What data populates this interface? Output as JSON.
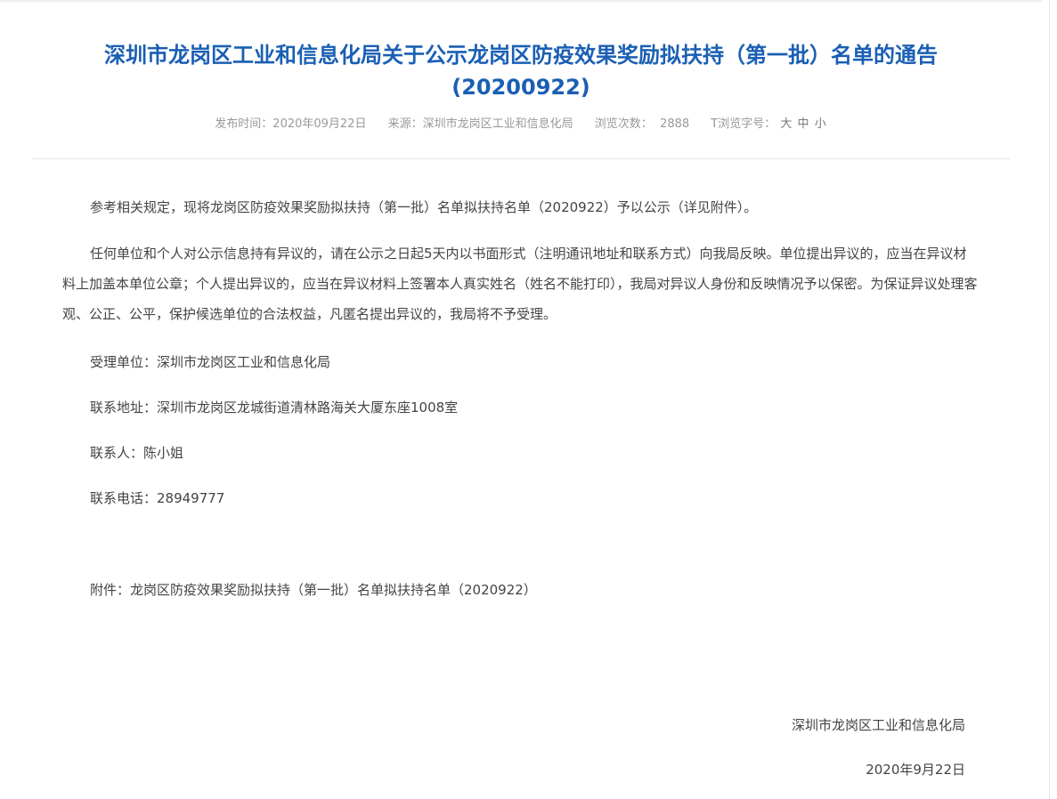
{
  "article": {
    "title_line1": "深圳市龙岗区工业和信息化局关于公示龙岗区防疫效果奖励拟扶持（第一批）名单的通告",
    "title_line2": "(20200922)",
    "meta": {
      "publish_label": "发布时间：",
      "publish_date": "2020年09月22日",
      "source_label": "来源：",
      "source": "深圳市龙岗区工业和信息化局",
      "views_label": "浏览次数：",
      "views": "2888",
      "font_label": "T浏览字号：",
      "font_large": "大",
      "font_medium": "中",
      "font_small": "小"
    },
    "paragraphs": {
      "p1": "参考相关规定，现将龙岗区防疫效果奖励拟扶持（第一批）名单拟扶持名单（2020922）予以公示（详见附件）。",
      "p2": "任何单位和个人对公示信息持有异议的，请在公示之日起5天内以书面形式（注明通讯地址和联系方式）向我局反映。单位提出异议的，应当在异议材料上加盖本单位公章；个人提出异议的，应当在异议材料上签署本人真实姓名（姓名不能打印），我局对异议人身份和反映情况予以保密。为保证异议处理客观、公正、公平，保护候选单位的合法权益，凡匿名提出异议的，我局将不予受理。",
      "handler": "受理单位：深圳市龙岗区工业和信息化局",
      "address": "联系地址：深圳市龙岗区龙城街道清林路海关大厦东座1008室",
      "contact": "联系人：陈小姐",
      "phone": "联系电话：28949777",
      "attachment": "附件：龙岗区防疫效果奖励拟扶持（第一批）名单拟扶持名单（2020922）"
    },
    "signature": {
      "org": "深圳市龙岗区工业和信息化局",
      "date": "2020年9月22日"
    }
  },
  "colors": {
    "title": "#1a5fb4",
    "text": "#444444",
    "meta": "#999999"
  }
}
